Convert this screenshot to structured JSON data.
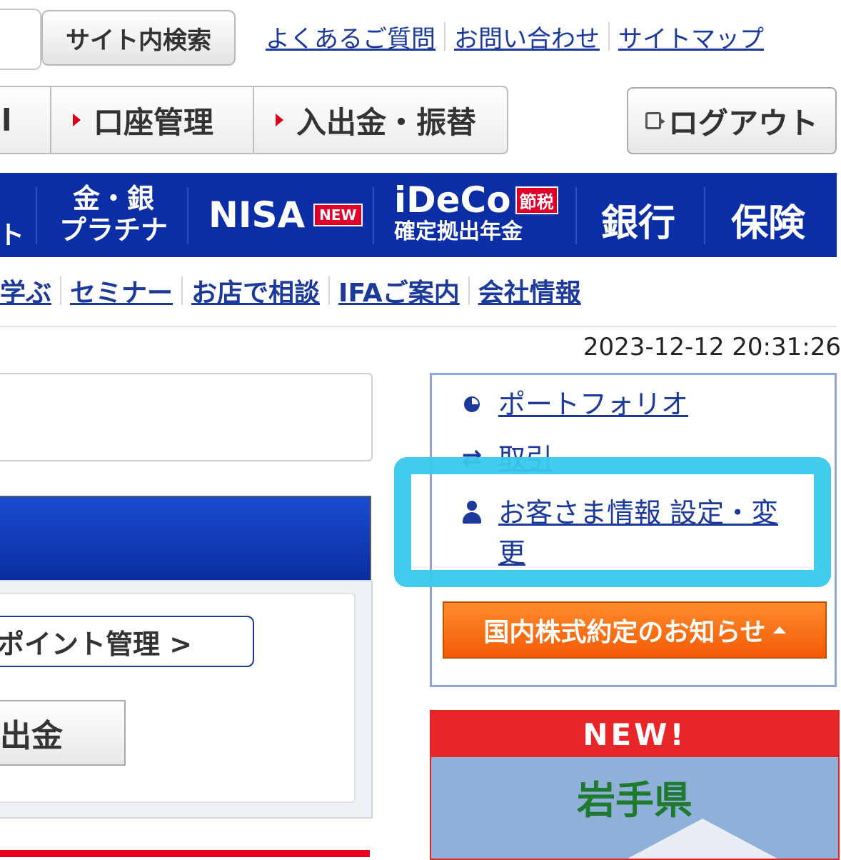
{
  "header": {
    "search_button": "サイト内検索",
    "links": [
      "よくあるご質問",
      "お問い合わせ",
      "サイトマップ"
    ]
  },
  "nav": {
    "partial_tab": "l",
    "tabs": [
      "口座管理",
      "入出金・振替"
    ],
    "logout": "ログアウト"
  },
  "product_bar": {
    "partial": "ト",
    "gold_line1": "金・銀",
    "gold_line2": "プラチナ",
    "nisa": "NISA",
    "nisa_badge": "NEW",
    "ideco": "iDeCo",
    "ideco_badge": "節税",
    "ideco_sub": "確定拠出年金",
    "bank": "銀行",
    "insurance": "保険"
  },
  "sub_links": [
    "学ぶ",
    "セミナー",
    "お店で相談",
    "IFAご案内",
    "会社情報"
  ],
  "datetime": "2023-12-12 20:31:26",
  "left": {
    "point_button": "ポイント管理 >",
    "withdraw_button": "出金"
  },
  "menu": {
    "portfolio": "ポートフォリオ",
    "trade": "取引",
    "customer_info_line1": "お客さま情報 設定・変",
    "customer_info_line2": "更",
    "notice_button": "国内株式約定のお知らせ"
  },
  "banner": {
    "head": "NEW!",
    "title": "岩手県"
  },
  "colors": {
    "brand_blue": "#0b2ea6",
    "link_blue": "#1b3a9c",
    "highlight": "#37c8ec",
    "notice_orange": "#f35a05"
  }
}
